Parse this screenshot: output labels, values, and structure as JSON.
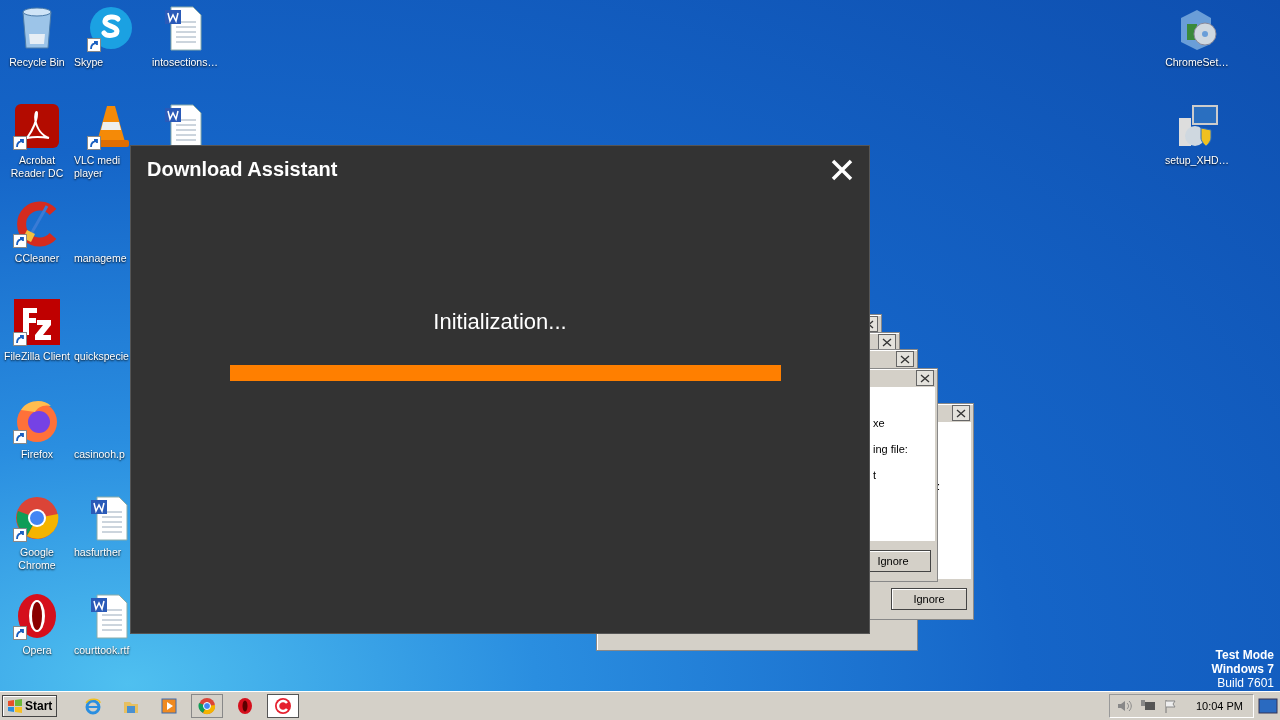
{
  "desktop": {
    "columns": [
      [
        {
          "label": "Recycle Bin",
          "kind": "recycle",
          "shortcut": false
        },
        {
          "label": "Acrobat Reader DC",
          "kind": "acrobat",
          "shortcut": true
        },
        {
          "label": "CCleaner",
          "kind": "ccleaner",
          "shortcut": true
        },
        {
          "label": "FileZilla Client",
          "kind": "filezilla",
          "shortcut": true
        },
        {
          "label": "Firefox",
          "kind": "firefox",
          "shortcut": true
        },
        {
          "label": "Google Chrome",
          "kind": "chrome",
          "shortcut": true
        },
        {
          "label": "Opera",
          "kind": "opera",
          "shortcut": true
        }
      ],
      [
        {
          "label": "Skype",
          "kind": "skype",
          "shortcut": true
        },
        {
          "label": "VLC medi player",
          "kind": "vlc",
          "shortcut": true
        },
        {
          "label": "manageme",
          "kind": "covered"
        },
        {
          "label": "quickspecie",
          "kind": "covered"
        },
        {
          "label": "casinooh.p",
          "kind": "covered"
        },
        {
          "label": "hasfurther",
          "kind": "word",
          "shortcut": false
        },
        {
          "label": "courttook.rtf",
          "kind": "word",
          "shortcut": false
        }
      ],
      [
        {
          "label": "intosections…",
          "kind": "word",
          "shortcut": false
        },
        {
          "kind": "word",
          "shortcut": false
        }
      ]
    ],
    "right_icons": [
      {
        "label": "ChromeSet…",
        "kind": "installer",
        "shortcut": false
      },
      {
        "label": "setup_XHD…",
        "kind": "setup",
        "shortcut": false
      }
    ]
  },
  "error_windows": [
    {
      "kind": "stub"
    },
    {
      "kind": "stub"
    },
    {
      "kind": "stub"
    },
    {
      "kind": "message",
      "lines": [
        "xe",
        "ing file:",
        "t"
      ],
      "button": "Ignore"
    },
    {
      "kind": "message",
      "lines": [
        ":"
      ],
      "button": "Ignore"
    }
  ],
  "dialog": {
    "title": "Download Assistant",
    "status": "Initialization...",
    "progress": {
      "level": 1
    }
  },
  "watermark": [
    "Test Mode",
    "Windows 7",
    "Build 7601"
  ],
  "taskbar": {
    "start": "Start",
    "items": [
      {
        "kind": "ie",
        "selected": false,
        "button": false
      },
      {
        "kind": "explorer",
        "selected": false,
        "button": false
      },
      {
        "kind": "media",
        "selected": false,
        "button": false
      },
      {
        "kind": "chrome",
        "selected": false,
        "button": true
      },
      {
        "kind": "opera",
        "selected": false,
        "button": false
      },
      {
        "kind": "ccleaner",
        "selected": true,
        "button": true
      }
    ],
    "clock": "10:04 PM"
  }
}
